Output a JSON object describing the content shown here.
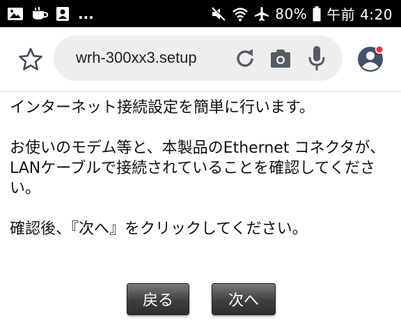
{
  "status_bar": {
    "overflow": "...",
    "battery": "80%",
    "time": "午前 4:20",
    "icons": [
      "image-icon",
      "cup-icon",
      "contact-icon",
      "mute-icon",
      "wifi-icon",
      "airplane-icon",
      "battery-icon"
    ]
  },
  "toolbar": {
    "url": "wrh-300xx3.setup",
    "icons": [
      "star-icon",
      "reload-icon",
      "camera-icon",
      "mic-icon",
      "account-icon"
    ],
    "notification_dot_color": "#e53935"
  },
  "content": {
    "line1": "インターネット接続設定を簡単に行います。",
    "line2": "お使いのモデム等と、本製品のEthernet コネクタが、",
    "line3": "LANケーブルで接続されていることを確認してください。",
    "line4": "確認後、『次へ』をクリックしてください。"
  },
  "buttons": {
    "back": "戻る",
    "next": "次へ"
  }
}
